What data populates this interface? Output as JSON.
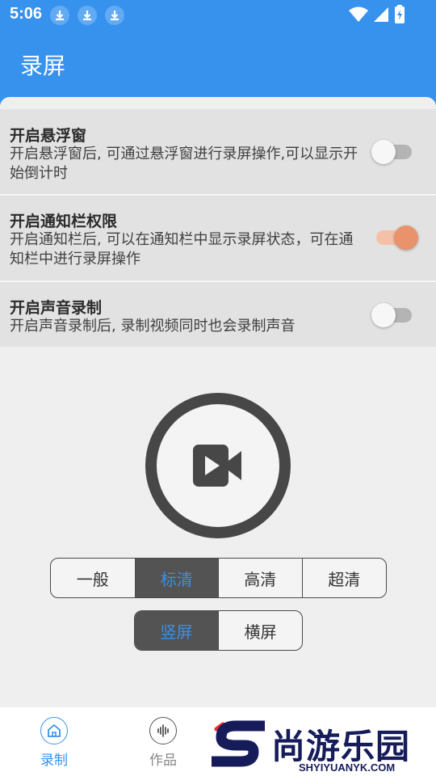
{
  "status_bar": {
    "time": "5:06",
    "icons": [
      "download-icon",
      "download-icon",
      "download-icon",
      "wifi-icon",
      "signal-icon",
      "battery-icon"
    ]
  },
  "app": {
    "title": "录屏"
  },
  "settings": [
    {
      "title": "开启悬浮窗",
      "desc": "开启悬浮窗后, 可通过悬浮窗进行录屏操作,可以显示开始倒计时",
      "enabled": false
    },
    {
      "title": "开启通知栏权限",
      "desc": "开启通知栏后, 可以在通知栏中显示录屏状态，可在通知栏中进行录屏操作",
      "enabled": true
    },
    {
      "title": "开启声音录制",
      "desc": "开启声音录制后, 录制视频同时也会录制声音",
      "enabled": false
    }
  ],
  "record_button": {
    "icon": "video-camera-icon"
  },
  "quality": {
    "options": [
      "一般",
      "标清",
      "高清",
      "超清"
    ],
    "selected": "标清"
  },
  "orientation": {
    "options": [
      "竖屏",
      "横屏"
    ],
    "selected": "竖屏"
  },
  "bottom_nav": [
    {
      "label": "录制",
      "icon": "home-icon",
      "active": true
    },
    {
      "label": "作品",
      "icon": "audio-wave-icon",
      "active": false
    }
  ],
  "watermark": {
    "text": "尚游乐园",
    "url": "SHYIYUANYK.COM"
  },
  "colors": {
    "primary": "#3792ee",
    "toggle_on": "#e8936c",
    "segment_selected_bg": "#535353",
    "segment_selected_text": "#3a8fe6",
    "watermark": "#161c5a"
  }
}
